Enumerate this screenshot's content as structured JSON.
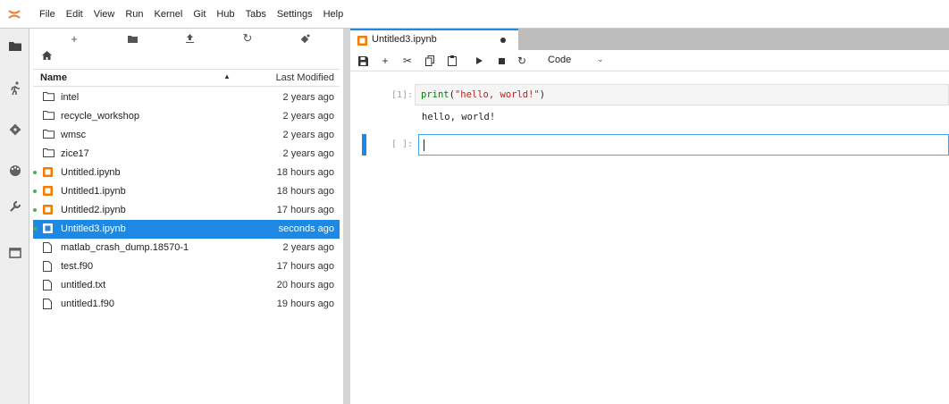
{
  "menu": [
    "File",
    "Edit",
    "View",
    "Run",
    "Kernel",
    "Git",
    "Hub",
    "Tabs",
    "Settings",
    "Help"
  ],
  "colors": {
    "accent": "#1e88e5",
    "notebook_icon": "#f57c00",
    "modified_dot": "#4caf50"
  },
  "activity_icons": [
    "folder-icon",
    "running-icon",
    "git-icon",
    "palette-icon",
    "wrench-icon",
    "tabs-icon"
  ],
  "file_toolbar_icons": [
    "new-launcher-icon",
    "new-folder-icon",
    "upload-icon",
    "refresh-icon",
    "git-clone-icon"
  ],
  "breadcrumb_icon": "home-icon",
  "filebrowser": {
    "col_name": "Name",
    "col_modified": "Last Modified",
    "files": [
      {
        "name": "intel",
        "modified": "2 years ago",
        "type": "folder",
        "running": false,
        "selected": false
      },
      {
        "name": "recycle_workshop",
        "modified": "2 years ago",
        "type": "folder",
        "running": false,
        "selected": false
      },
      {
        "name": "wmsc",
        "modified": "2 years ago",
        "type": "folder",
        "running": false,
        "selected": false
      },
      {
        "name": "zice17",
        "modified": "2 years ago",
        "type": "folder",
        "running": false,
        "selected": false
      },
      {
        "name": "Untitled.ipynb",
        "modified": "18 hours ago",
        "type": "notebook",
        "running": true,
        "selected": false
      },
      {
        "name": "Untitled1.ipynb",
        "modified": "18 hours ago",
        "type": "notebook",
        "running": true,
        "selected": false
      },
      {
        "name": "Untitled2.ipynb",
        "modified": "17 hours ago",
        "type": "notebook",
        "running": true,
        "selected": false
      },
      {
        "name": "Untitled3.ipynb",
        "modified": "seconds ago",
        "type": "notebook",
        "running": true,
        "selected": true
      },
      {
        "name": "matlab_crash_dump.18570-1",
        "modified": "2 years ago",
        "type": "file",
        "running": false,
        "selected": false
      },
      {
        "name": "test.f90",
        "modified": "17 hours ago",
        "type": "file",
        "running": false,
        "selected": false
      },
      {
        "name": "untitled.txt",
        "modified": "20 hours ago",
        "type": "file",
        "running": false,
        "selected": false
      },
      {
        "name": "untitled1.f90",
        "modified": "19 hours ago",
        "type": "file",
        "running": false,
        "selected": false
      }
    ]
  },
  "notebook": {
    "tab_title": "Untitled3.ipynb",
    "toolbar_icons": [
      "save-icon",
      "insert-cell-icon",
      "cut-icon",
      "copy-icon",
      "paste-icon",
      "run-icon",
      "stop-icon",
      "restart-icon"
    ],
    "cell_type": "Code",
    "cells": [
      {
        "prompt": "[1]:",
        "code_fn": "print",
        "code_open": "(",
        "code_str": "\"hello, world!\"",
        "code_close": ")",
        "output": "hello, world!"
      },
      {
        "prompt": "[ ]:",
        "code": ""
      }
    ]
  }
}
